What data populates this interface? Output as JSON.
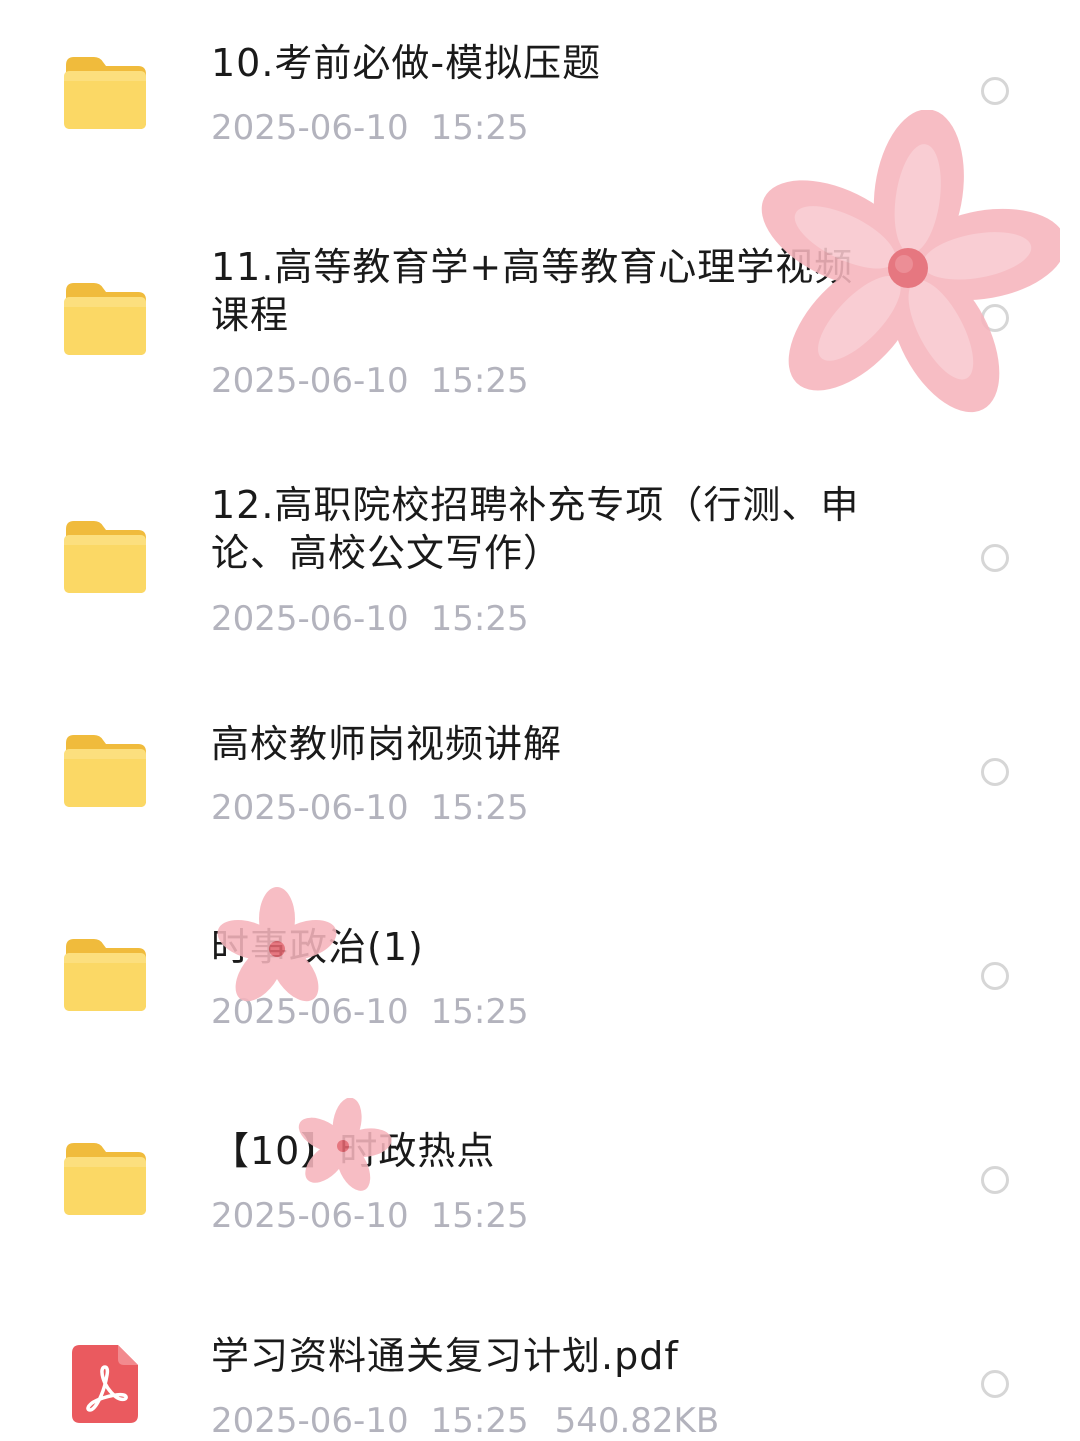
{
  "files": [
    {
      "name": "10.考前必做-模拟压题",
      "date": "2025-06-10",
      "time": "15:25",
      "type": "folder"
    },
    {
      "name": "11.高等教育学+高等教育心理学视频\n课程",
      "date": "2025-06-10",
      "time": "15:25",
      "type": "folder"
    },
    {
      "name": "12.高职院校招聘补充专项（行测、申\n论、高校公文写作）",
      "date": "2025-06-10",
      "time": "15:25",
      "type": "folder"
    },
    {
      "name": "高校教师岗视频讲解",
      "date": "2025-06-10",
      "time": "15:25",
      "type": "folder"
    },
    {
      "name": "时事政治(1)",
      "date": "2025-06-10",
      "time": "15:25",
      "type": "folder"
    },
    {
      "name": "【10】时政热点",
      "date": "2025-06-10",
      "time": "15:25",
      "type": "folder"
    },
    {
      "name": "学习资料通关复习计划.pdf",
      "date": "2025-06-10",
      "time": "15:25",
      "size": "540.82KB",
      "type": "pdf"
    }
  ],
  "icons": {
    "folder": "folder-icon",
    "pdf": "pdf-icon",
    "select": "radio-circle-icon",
    "sticker": "flower-sticker"
  },
  "colors": {
    "folder_top": "#fbd865",
    "folder_bottom": "#f6c74a",
    "pdf_red": "#ea5a5f",
    "text": "#1a1a1a",
    "meta": "#b3b3bd",
    "petal": "#f6b5bd",
    "flower_center": "#e3656f"
  }
}
